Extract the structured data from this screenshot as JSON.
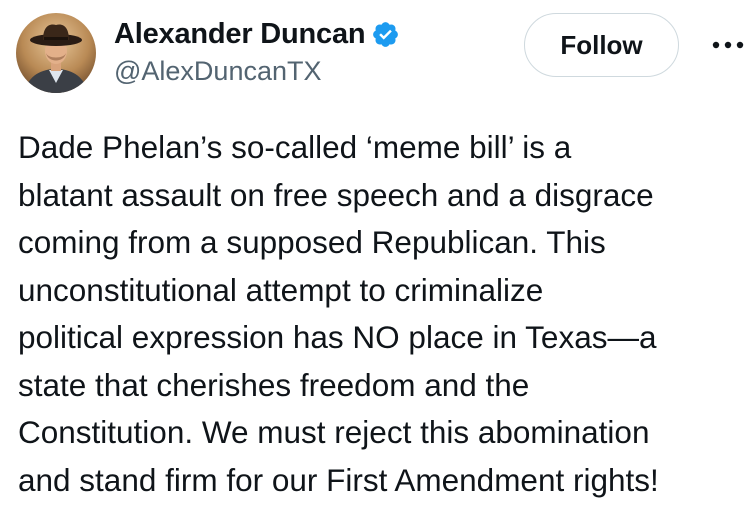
{
  "author": {
    "display_name": "Alexander Duncan",
    "handle": "@AlexDuncanTX",
    "verified": true,
    "verified_icon": "verified-badge-icon",
    "avatar_icon": "avatar-photo"
  },
  "actions": {
    "follow_label": "Follow",
    "more_icon": "more-options-icon"
  },
  "tweet": {
    "lines": [
      "Dade Phelan’s so-called ‘meme bill’ is a",
      "blatant assault on free speech and a disgrace",
      "coming from a supposed Republican. This",
      "unconstitutional attempt to criminalize",
      "political expression has NO place in Texas—a",
      "state that cherishes freedom and the",
      "Constitution. We must reject this abomination",
      "and stand firm for our First Amendment rights!"
    ]
  },
  "colors": {
    "text_primary": "#0f1419",
    "text_secondary": "#536471",
    "verified_blue": "#1d9bf0",
    "border": "#cfd9de"
  }
}
